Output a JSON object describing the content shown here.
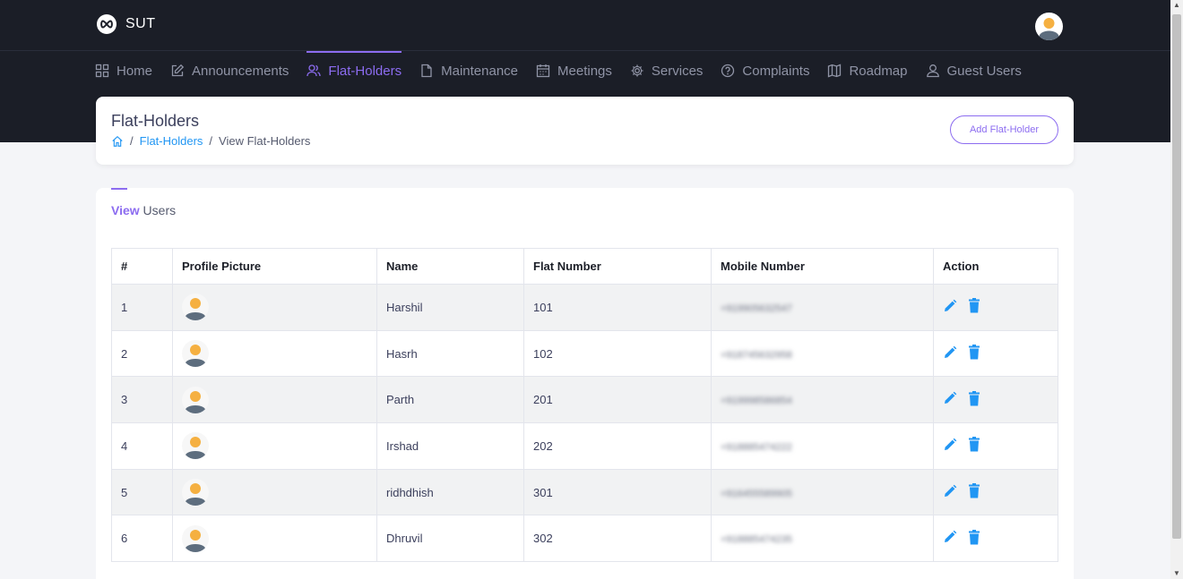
{
  "app": {
    "name": "SUT"
  },
  "nav": [
    {
      "label": "Home",
      "icon": "grid-icon",
      "active": false
    },
    {
      "label": "Announcements",
      "icon": "edit-icon",
      "active": false
    },
    {
      "label": "Flat-Holders",
      "icon": "users-icon",
      "active": true
    },
    {
      "label": "Maintenance",
      "icon": "file-icon",
      "active": false
    },
    {
      "label": "Meetings",
      "icon": "calendar-icon",
      "active": false
    },
    {
      "label": "Services",
      "icon": "gear-icon",
      "active": false
    },
    {
      "label": "Complaints",
      "icon": "help-icon",
      "active": false
    },
    {
      "label": "Roadmap",
      "icon": "map-icon",
      "active": false
    },
    {
      "label": "Guest Users",
      "icon": "user-icon",
      "active": false
    }
  ],
  "header": {
    "title": "Flat-Holders",
    "breadcrumb": {
      "sep": "/",
      "link": "Flat-Holders",
      "current": "View Flat-Holders"
    },
    "add_button": "Add Flat-Holder"
  },
  "section": {
    "view_bold": "View",
    "view_rest": " Users"
  },
  "table": {
    "headers": [
      "#",
      "Profile Picture",
      "Name",
      "Flat Number",
      "Mobile Number",
      "Action"
    ],
    "rows": [
      {
        "num": "1",
        "name": "Harshil",
        "flat": "101",
        "mobile": "+919905632547"
      },
      {
        "num": "2",
        "name": "Hasrh",
        "flat": "102",
        "mobile": "+918745632958"
      },
      {
        "num": "3",
        "name": "Parth",
        "flat": "201",
        "mobile": "+919998586854"
      },
      {
        "num": "4",
        "name": "Irshad",
        "flat": "202",
        "mobile": "+918885474222"
      },
      {
        "num": "5",
        "name": "ridhdhish",
        "flat": "301",
        "mobile": "+916455589905"
      },
      {
        "num": "6",
        "name": "Dhruvil",
        "flat": "302",
        "mobile": "+918885474235"
      }
    ]
  },
  "colors": {
    "accent": "#8c6cf0",
    "topbar": "#1b1e27",
    "action": "#2196f3"
  }
}
